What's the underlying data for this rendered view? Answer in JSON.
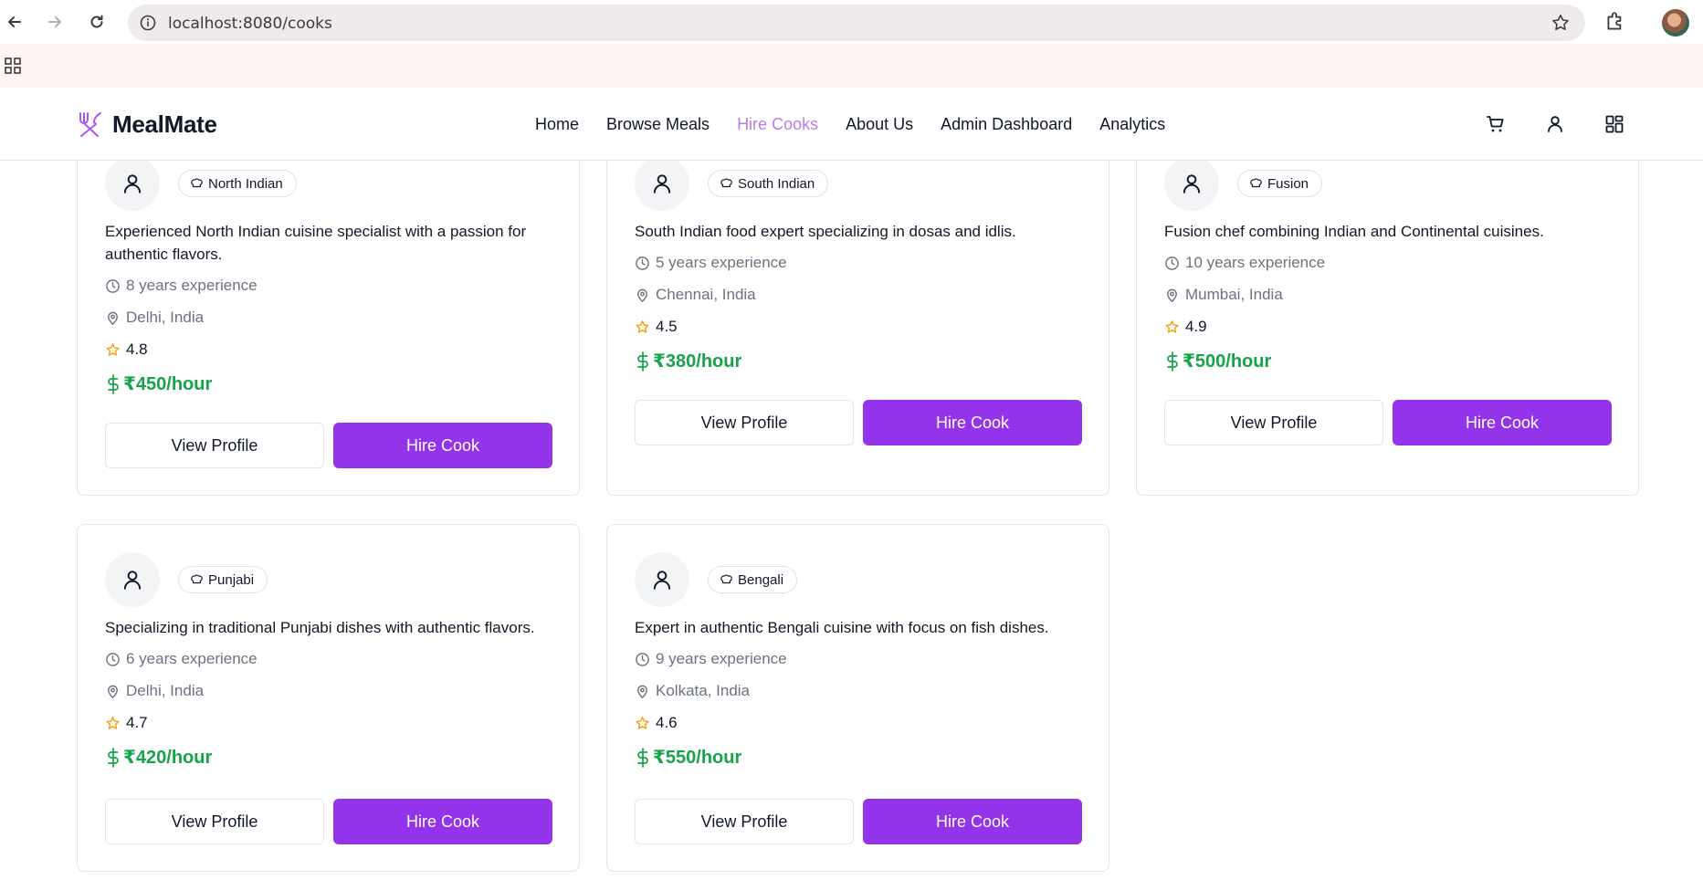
{
  "browser": {
    "url": "localhost:8080/cooks"
  },
  "site": {
    "brand": "MealMate",
    "nav": [
      {
        "label": "Home",
        "active": false
      },
      {
        "label": "Browse Meals",
        "active": false
      },
      {
        "label": "Hire Cooks",
        "active": true
      },
      {
        "label": "About Us",
        "active": false
      },
      {
        "label": "Admin Dashboard",
        "active": false
      },
      {
        "label": "Analytics",
        "active": false
      }
    ],
    "header_icons": [
      "cart-icon",
      "user-icon",
      "dashboard-icon"
    ]
  },
  "colors": {
    "brand_purple": "#9333ea",
    "nav_active": "#b77cf0",
    "price_green": "#16a34a",
    "star_orange": "#f59e0b"
  },
  "cooks": [
    {
      "cuisine": "North Indian",
      "description": "Experienced North Indian cuisine specialist with a passion for authentic flavors.",
      "experience": "8 years experience",
      "location": "Delhi, India",
      "rating": "4.8",
      "price": "₹450/hour",
      "view_label": "View Profile",
      "hire_label": "Hire Cook"
    },
    {
      "cuisine": "South Indian",
      "description": "South Indian food expert specializing in dosas and idlis.",
      "experience": "5 years experience",
      "location": "Chennai, India",
      "rating": "4.5",
      "price": "₹380/hour",
      "view_label": "View Profile",
      "hire_label": "Hire Cook"
    },
    {
      "cuisine": "Fusion",
      "description": "Fusion chef combining Indian and Continental cuisines.",
      "experience": "10 years experience",
      "location": "Mumbai, India",
      "rating": "4.9",
      "price": "₹500/hour",
      "view_label": "View Profile",
      "hire_label": "Hire Cook"
    },
    {
      "cuisine": "Punjabi",
      "description": "Specializing in traditional Punjabi dishes with authentic flavors.",
      "experience": "6 years experience",
      "location": "Delhi, India",
      "rating": "4.7",
      "price": "₹420/hour",
      "view_label": "View Profile",
      "hire_label": "Hire Cook"
    },
    {
      "cuisine": "Bengali",
      "description": "Expert in authentic Bengali cuisine with focus on fish dishes.",
      "experience": "9 years experience",
      "location": "Kolkata, India",
      "rating": "4.6",
      "price": "₹550/hour",
      "view_label": "View Profile",
      "hire_label": "Hire Cook"
    }
  ]
}
